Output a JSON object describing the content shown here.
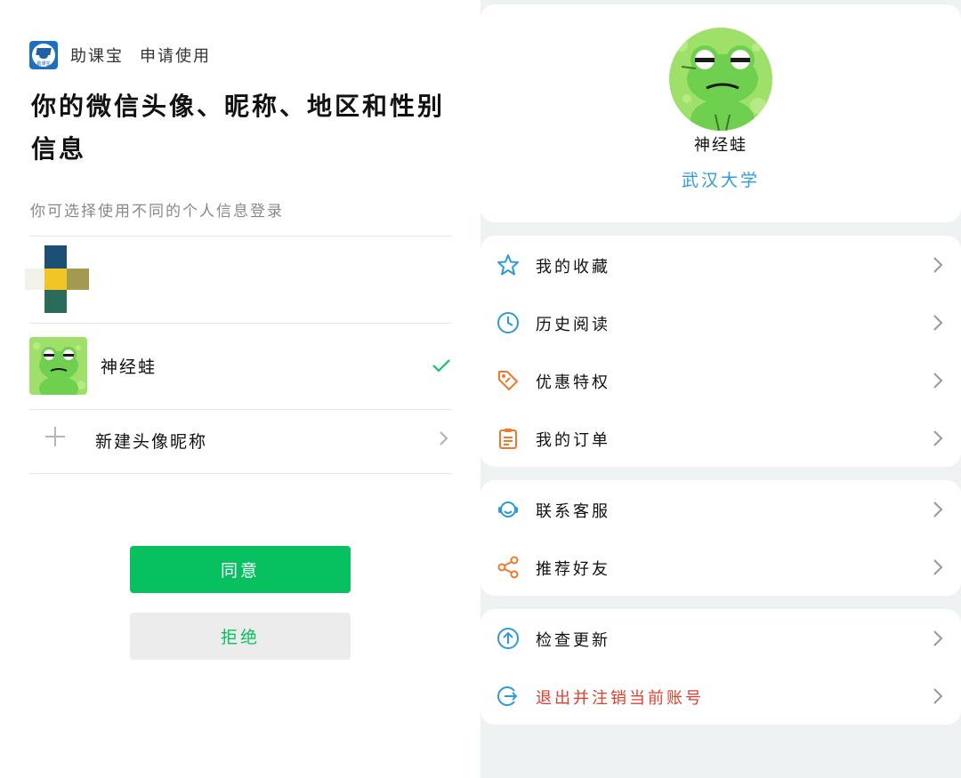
{
  "auth": {
    "app_name": "助课宝",
    "app_logo_text": "助课宝",
    "request_label": "申请使用",
    "headline": "你的微信头像、昵称、地区和性别信息",
    "hint": "你可选择使用不同的个人信息登录",
    "options": [
      {
        "name": "神经蛙",
        "selected": true
      }
    ],
    "new_profile_label": "新建头像昵称",
    "agree_label": "同意",
    "reject_label": "拒绝",
    "colors": {
      "primary": "#07c160",
      "reject_bg": "#ececec"
    }
  },
  "profile": {
    "name": "神经蛙",
    "school": "武汉大学",
    "school_color": "#2e9ad8"
  },
  "menu": {
    "group1": [
      {
        "label": "我的收藏",
        "icon": "star-icon"
      },
      {
        "label": "历史阅读",
        "icon": "clock-icon"
      },
      {
        "label": "优惠特权",
        "icon": "price-tag-icon"
      },
      {
        "label": "我的订单",
        "icon": "clipboard-icon"
      }
    ],
    "group2": [
      {
        "label": "联系客服",
        "icon": "headset-icon"
      },
      {
        "label": "推荐好友",
        "icon": "share-icon"
      }
    ],
    "group3": [
      {
        "label": "检查更新",
        "icon": "arrow-up-circle-icon"
      },
      {
        "label": "退出并注销当前账号",
        "icon": "logout-icon",
        "color": "#e23c2c"
      }
    ]
  }
}
